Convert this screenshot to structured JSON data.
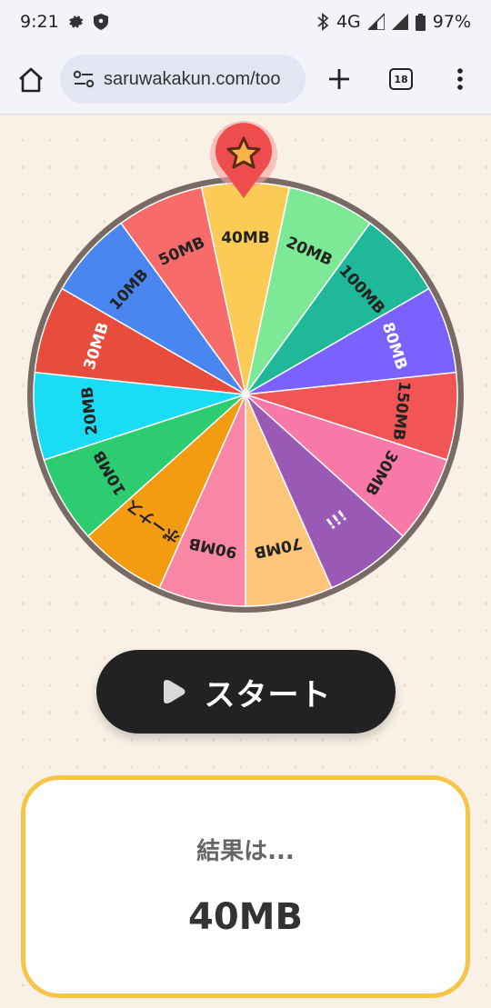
{
  "status_bar": {
    "time": "9:21",
    "network": "4G",
    "battery": "97%"
  },
  "browser": {
    "url": "saruwakakun.com/too",
    "tab_count": "18"
  },
  "wheel": {
    "segments": [
      {
        "label": "40MB",
        "color": "#fccb55",
        "text_color": "#222222"
      },
      {
        "label": "20MB",
        "color": "#7de895",
        "text_color": "#222222"
      },
      {
        "label": "100MB",
        "color": "#1fb999",
        "text_color": "#222222"
      },
      {
        "label": "80MB",
        "color": "#7b61ff",
        "text_color": "#ffffff"
      },
      {
        "label": "150MB",
        "color": "#f25555",
        "text_color": "#222222"
      },
      {
        "label": "30MB",
        "color": "#f879a8",
        "text_color": "#222222"
      },
      {
        "label": "¡¡¡",
        "color": "#9b59b6",
        "text_color": "#ffffff"
      },
      {
        "label": "70MB",
        "color": "#fdc57a",
        "text_color": "#222222"
      },
      {
        "label": "90MB",
        "color": "#fa86a6",
        "text_color": "#222222"
      },
      {
        "label": "ボーナス",
        "color": "#f39c12",
        "text_color": "#222222"
      },
      {
        "label": "10MB",
        "color": "#2ecc71",
        "text_color": "#222222"
      },
      {
        "label": "20MB",
        "color": "#1adcf5",
        "text_color": "#222222"
      },
      {
        "label": "30MB",
        "color": "#e74c3c",
        "text_color": "#ffffff"
      },
      {
        "label": "10MB",
        "color": "#4a86f0",
        "text_color": "#222222"
      },
      {
        "label": "50MB",
        "color": "#f76b6b",
        "text_color": "#222222"
      }
    ],
    "rim_color": "#7a6a66"
  },
  "start_button": {
    "label": "スタート"
  },
  "result": {
    "heading": "結果は...",
    "value": "40MB"
  }
}
